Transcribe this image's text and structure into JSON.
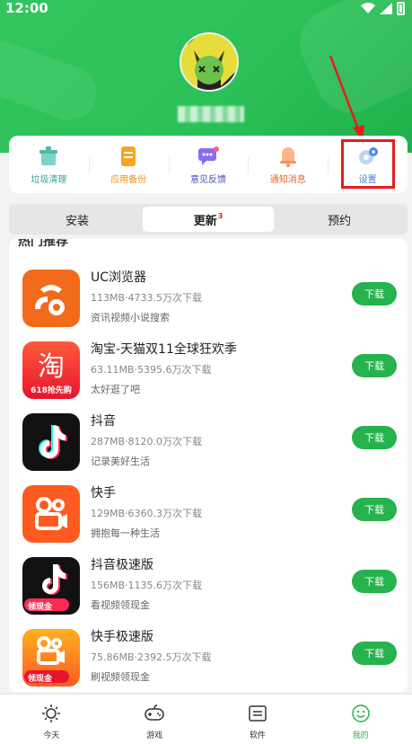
{
  "status_bar": {
    "time": "12:00"
  },
  "toolbar": {
    "items": [
      {
        "label": "垃圾清理",
        "icon": "trash-clean-icon",
        "color": "#3aa0a0"
      },
      {
        "label": "应用备份",
        "icon": "backup-icon",
        "color": "#e8901a"
      },
      {
        "label": "意见反馈",
        "icon": "feedback-icon",
        "color": "#6a4fd8"
      },
      {
        "label": "通知消息",
        "icon": "bell-icon",
        "color": "#e8901a"
      },
      {
        "label": "设置",
        "icon": "gear-icon",
        "color": "#3b7ee0"
      }
    ]
  },
  "tabs": [
    {
      "label": "安装",
      "active": false
    },
    {
      "label": "更新",
      "badge": "3",
      "active": true
    },
    {
      "label": "预约",
      "active": false
    }
  ],
  "list_cut_label": "热门推荐",
  "apps": [
    {
      "name": "UC浏览器",
      "meta": "113MB·4733.5万次下载",
      "desc": "资讯视频小说搜索",
      "button": "下载",
      "icon": "uc-browser-icon"
    },
    {
      "name": "淘宝-天猫双11全球狂欢季",
      "meta": "63.11MB·5395.6万次下载",
      "desc": "太好逛了吧",
      "button": "下载",
      "icon": "taobao-icon"
    },
    {
      "name": "抖音",
      "meta": "287MB·8120.0万次下载",
      "desc": "记录美好生活",
      "button": "下载",
      "icon": "douyin-icon"
    },
    {
      "name": "快手",
      "meta": "129MB·6360.3万次下载",
      "desc": "拥抱每一种生活",
      "button": "下载",
      "icon": "kuaishou-icon"
    },
    {
      "name": "抖音极速版",
      "meta": "156MB·1135.6万次下载",
      "desc": "看视频领现金",
      "button": "下载",
      "icon": "douyin-lite-icon"
    },
    {
      "name": "快手极速版",
      "meta": "75.86MB·2392.5万次下载",
      "desc": "刷视频领现金",
      "button": "下载",
      "icon": "kuaishou-lite-icon"
    }
  ],
  "icon_badges": {
    "taobao_tag": "618抢先购",
    "lite_tag": "领现金"
  },
  "bottom_nav": [
    {
      "label": "今天",
      "icon": "sun-icon",
      "active": false
    },
    {
      "label": "游戏",
      "icon": "gamepad-icon",
      "active": false
    },
    {
      "label": "软件",
      "icon": "software-icon",
      "active": false
    },
    {
      "label": "我的",
      "icon": "smile-icon",
      "active": true
    }
  ],
  "colors": {
    "brand_green": "#26b24c",
    "highlight_red": "#e61c1c"
  }
}
